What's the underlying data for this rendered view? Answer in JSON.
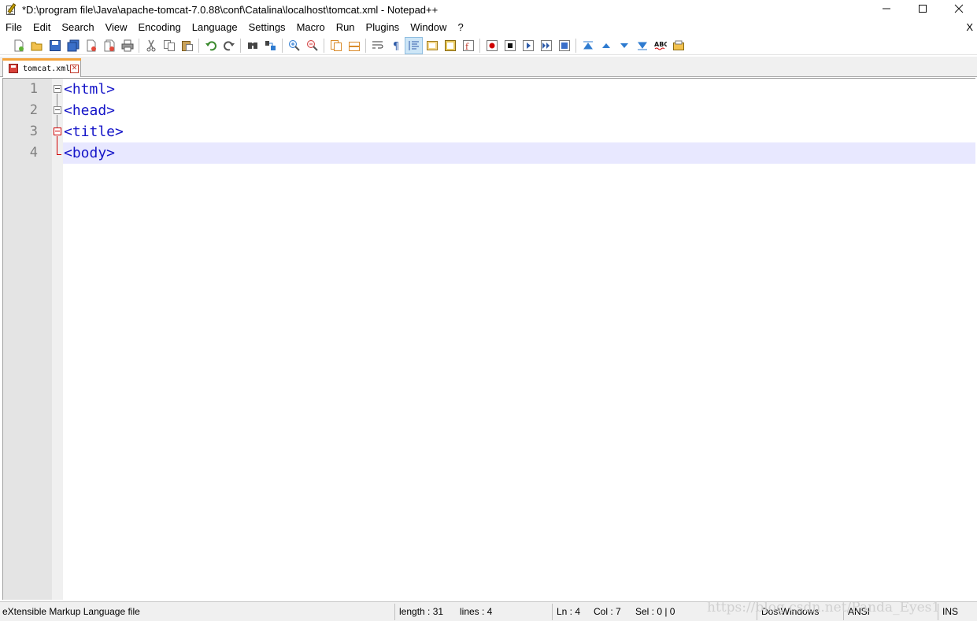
{
  "window": {
    "title": "*D:\\program file\\Java\\apache-tomcat-7.0.88\\conf\\Catalina\\localhost\\tomcat.xml - Notepad++",
    "minimize_label": "—",
    "maximize_label": "☐",
    "close_label": "✕"
  },
  "menu": {
    "items": [
      "File",
      "Edit",
      "Search",
      "View",
      "Encoding",
      "Language",
      "Settings",
      "Macro",
      "Run",
      "Plugins",
      "Window",
      "?"
    ],
    "close_doc": "X"
  },
  "toolbar": {
    "buttons": [
      "new-file-icon",
      "open-file-icon",
      "save-icon",
      "save-all-icon",
      "close-icon",
      "close-all-icon",
      "print-icon",
      "cut-icon",
      "copy-icon",
      "paste-icon",
      "undo-icon",
      "redo-icon",
      "find-icon",
      "replace-icon",
      "zoom-in-icon",
      "zoom-out-icon",
      "sync-vertical-icon",
      "sync-horizontal-icon",
      "word-wrap-icon",
      "show-all-chars-icon",
      "indent-guide-icon",
      "user-lang-icon",
      "doc-map-icon",
      "function-list-icon",
      "macro-record-icon",
      "macro-stop-icon",
      "macro-play-icon",
      "macro-run-multiple-icon",
      "macro-save-icon",
      "move-first-icon",
      "move-up-icon",
      "move-down-icon",
      "move-last-icon",
      "spell-check-icon",
      "clipboard-history-icon"
    ]
  },
  "tabs": [
    {
      "label": "tomcat.xml",
      "modified": true
    }
  ],
  "editor": {
    "lines": [
      {
        "num": "1",
        "text": "<html>"
      },
      {
        "num": "2",
        "text": "<head>"
      },
      {
        "num": "3",
        "text": "<title>"
      },
      {
        "num": "4",
        "text": "<body>"
      }
    ],
    "current_line": 4
  },
  "status": {
    "file_type": "eXtensible Markup Language file",
    "length": "length : 31",
    "lines": "lines : 4",
    "ln": "Ln : 4",
    "col": "Col : 7",
    "sel": "Sel : 0 | 0",
    "eol": "Dos\\Windows",
    "encoding": "ANSI",
    "mode": "INS"
  },
  "watermark": "https://blog.csdn.net/Panda_Eyes1",
  "colors": {
    "tag_text": "#1515c8",
    "current_line_bg": "#e8e8ff",
    "tab_accent": "#f3a23a",
    "gutter_bg": "#e4e4e4"
  }
}
